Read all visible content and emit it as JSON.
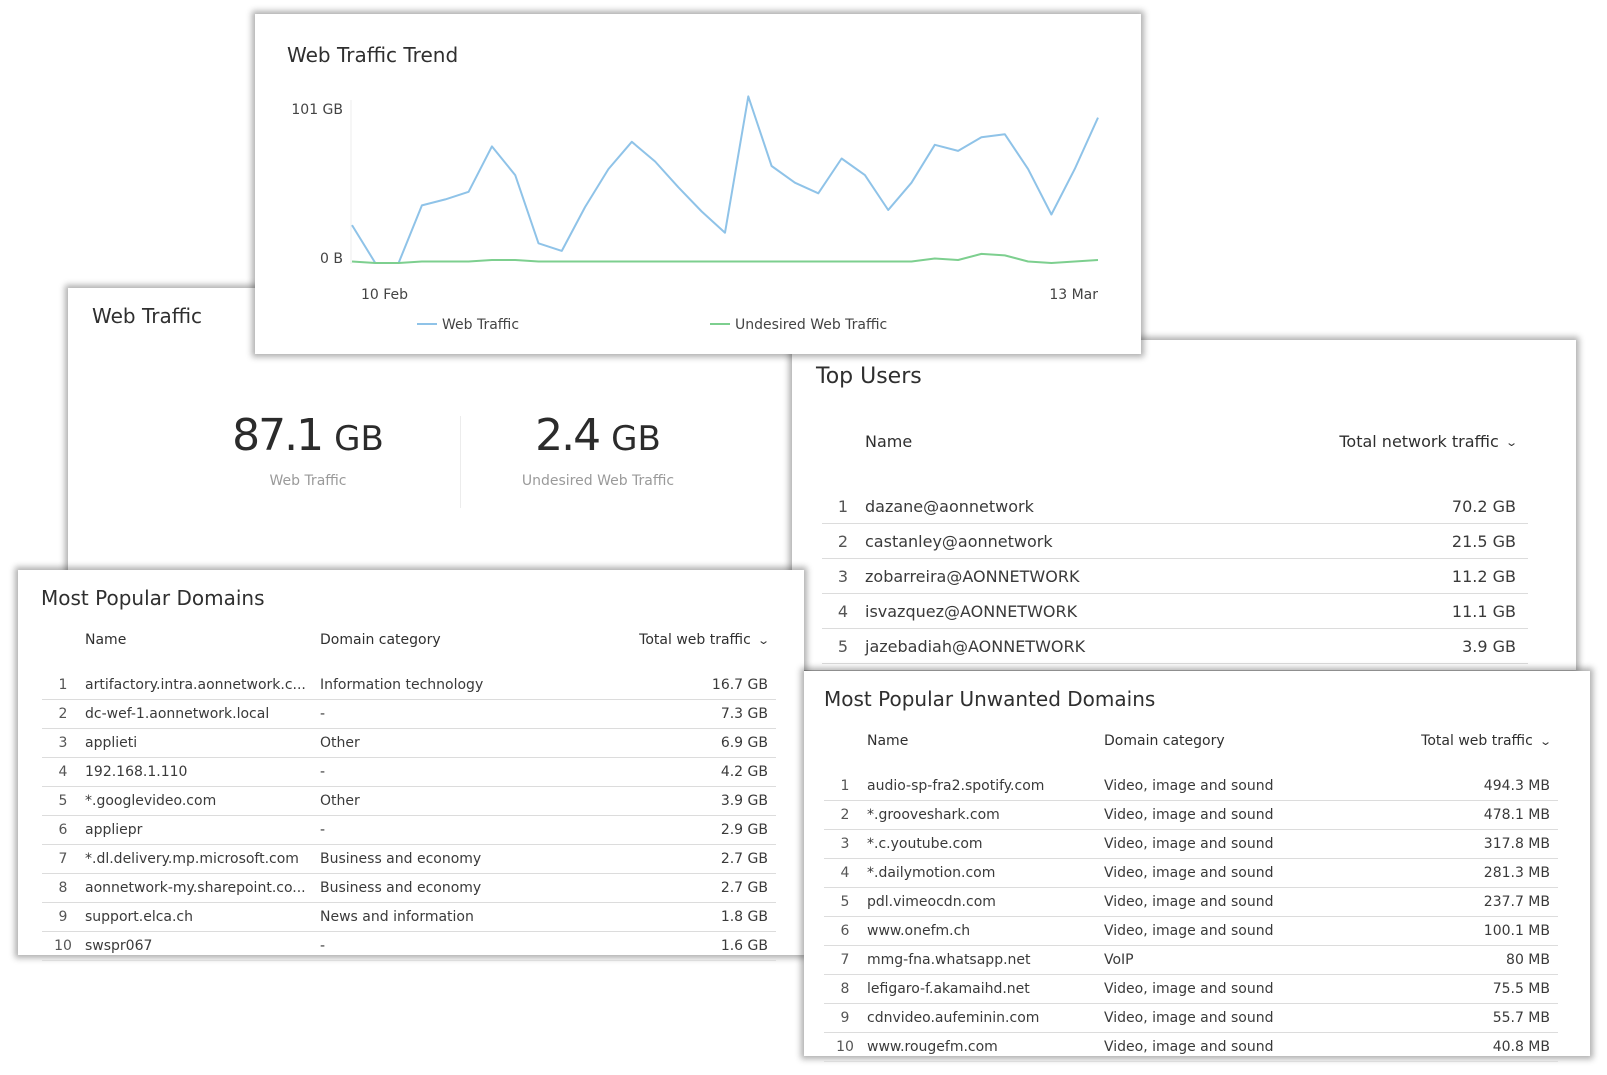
{
  "web_traffic": {
    "title": "Web Traffic",
    "total": {
      "value": "87.1",
      "unit": "GB",
      "label": "Web Traffic"
    },
    "undesired": {
      "value": "2.4",
      "unit": "GB",
      "label": "Undesired Web Traffic"
    }
  },
  "trend": {
    "title": "Web Traffic Trend",
    "ytick_top": "101 GB",
    "ytick_bottom": "0 B",
    "xtick_start": "10 Feb",
    "xtick_end": "13 Mar",
    "legend_web": "Web Traffic",
    "legend_undesired": "Undesired Web Traffic"
  },
  "chart_data": {
    "type": "line",
    "title": "Web Traffic Trend",
    "x_ticks": [
      "10 Feb",
      "13 Mar"
    ],
    "ylim": [
      0,
      101
    ],
    "y_unit": "GB",
    "y_ticks": [
      "0 B",
      "101 GB"
    ],
    "grid": false,
    "legend": "bottom",
    "series": [
      {
        "name": "Web Traffic",
        "color": "#8fc3e8",
        "values": [
          25,
          0,
          0,
          38,
          42,
          47,
          77,
          58,
          13,
          8,
          37,
          62,
          80,
          67,
          50,
          34,
          20,
          110,
          64,
          53,
          46,
          69,
          58,
          35,
          53,
          78,
          74,
          83,
          85,
          62,
          32,
          62,
          96
        ]
      },
      {
        "name": "Undesired Web Traffic",
        "color": "#7dcf8f",
        "values": [
          1,
          0,
          0,
          1,
          1,
          1,
          2,
          2,
          1,
          1,
          1,
          1,
          1,
          1,
          1,
          1,
          1,
          1,
          1,
          1,
          1,
          1,
          1,
          1,
          1,
          3,
          2,
          6,
          5,
          1,
          0,
          1,
          2
        ]
      }
    ]
  },
  "top_users": {
    "title": "Top Users",
    "col_name": "Name",
    "col_value": "Total network traffic",
    "rows": [
      {
        "rank": "1",
        "name": "dazane@aonnetwork",
        "value": "70.2 GB"
      },
      {
        "rank": "2",
        "name": "castanley@aonnetwork",
        "value": "21.5 GB"
      },
      {
        "rank": "3",
        "name": "zobarreira@AONNETWORK",
        "value": "11.2 GB"
      },
      {
        "rank": "4",
        "name": "isvazquez@AONNETWORK",
        "value": "11.1 GB"
      },
      {
        "rank": "5",
        "name": "jazebadiah@AONNETWORK",
        "value": "3.9 GB"
      }
    ]
  },
  "popular_domains": {
    "title": "Most Popular Domains",
    "col_name": "Name",
    "col_category": "Domain category",
    "col_value": "Total web traffic",
    "rows": [
      {
        "rank": "1",
        "name": "artifactory.intra.aonnetwork.c...",
        "category": "Information technology",
        "value": "16.7 GB"
      },
      {
        "rank": "2",
        "name": "dc-wef-1.aonnetwork.local",
        "category": "-",
        "value": "7.3 GB"
      },
      {
        "rank": "3",
        "name": "applieti",
        "category": "Other",
        "value": "6.9 GB"
      },
      {
        "rank": "4",
        "name": "192.168.1.110",
        "category": "-",
        "value": "4.2 GB"
      },
      {
        "rank": "5",
        "name": "*.googlevideo.com",
        "category": "Other",
        "value": "3.9 GB"
      },
      {
        "rank": "6",
        "name": "appliepr",
        "category": "-",
        "value": "2.9 GB"
      },
      {
        "rank": "7",
        "name": "*.dl.delivery.mp.microsoft.com",
        "category": "Business and economy",
        "value": "2.7 GB"
      },
      {
        "rank": "8",
        "name": "aonnetwork-my.sharepoint.co...",
        "category": "Business and economy",
        "value": "2.7 GB"
      },
      {
        "rank": "9",
        "name": "support.elca.ch",
        "category": "News and information",
        "value": "1.8 GB"
      },
      {
        "rank": "10",
        "name": "swspr067",
        "category": "-",
        "value": "1.6 GB"
      }
    ]
  },
  "unwanted_domains": {
    "title": "Most Popular Unwanted Domains",
    "col_name": "Name",
    "col_category": "Domain category",
    "col_value": "Total web traffic",
    "rows": [
      {
        "rank": "1",
        "name": "audio-sp-fra2.spotify.com",
        "category": "Video, image and sound",
        "value": "494.3 MB"
      },
      {
        "rank": "2",
        "name": "*.grooveshark.com",
        "category": "Video, image and sound",
        "value": "478.1 MB"
      },
      {
        "rank": "3",
        "name": "*.c.youtube.com",
        "category": "Video, image and sound",
        "value": "317.8 MB"
      },
      {
        "rank": "4",
        "name": "*.dailymotion.com",
        "category": "Video, image and sound",
        "value": "281.3 MB"
      },
      {
        "rank": "5",
        "name": "pdl.vimeocdn.com",
        "category": "Video, image and sound",
        "value": "237.7 MB"
      },
      {
        "rank": "6",
        "name": "www.onefm.ch",
        "category": "Video, image and sound",
        "value": "100.1 MB"
      },
      {
        "rank": "7",
        "name": "mmg-fna.whatsapp.net",
        "category": "VoIP",
        "value": "80 MB"
      },
      {
        "rank": "8",
        "name": "lefigaro-f.akamaihd.net",
        "category": "Video, image and sound",
        "value": "75.5 MB"
      },
      {
        "rank": "9",
        "name": "cdnvideo.aufeminin.com",
        "category": "Video, image and sound",
        "value": "55.7 MB"
      },
      {
        "rank": "10",
        "name": "www.rougefm.com",
        "category": "Video, image and sound",
        "value": "40.8 MB"
      }
    ]
  }
}
